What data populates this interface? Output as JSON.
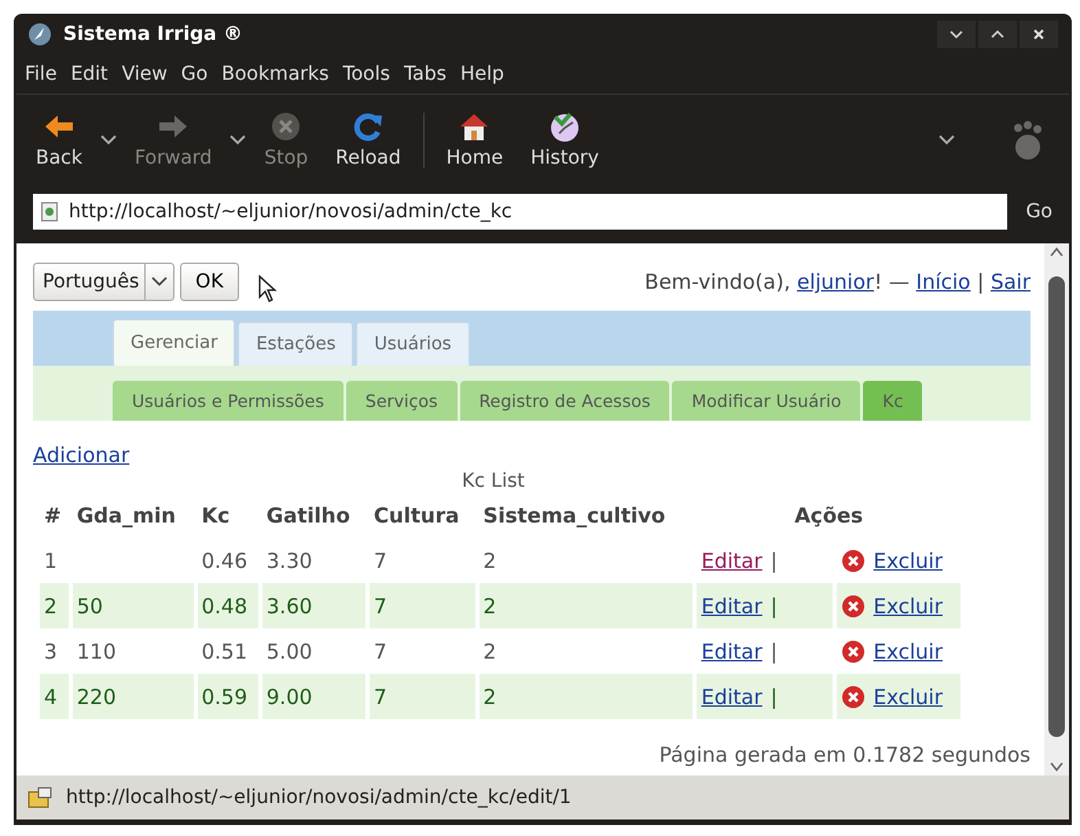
{
  "window": {
    "title": "Sistema Irriga ®"
  },
  "menu": [
    {
      "label": "File"
    },
    {
      "label": "Edit"
    },
    {
      "label": "View"
    },
    {
      "label": "Go"
    },
    {
      "label": "Bookmarks"
    },
    {
      "label": "Tools"
    },
    {
      "label": "Tabs"
    },
    {
      "label": "Help"
    }
  ],
  "toolbar": [
    {
      "kind": "back",
      "label": "Back",
      "disabled": false,
      "has_menu": true
    },
    {
      "kind": "forward",
      "label": "Forward",
      "disabled": true,
      "has_menu": true
    },
    {
      "kind": "stop",
      "label": "Stop",
      "disabled": true,
      "has_menu": false
    },
    {
      "kind": "reload",
      "label": "Reload",
      "disabled": false,
      "has_menu": false
    },
    {
      "kind": "home",
      "label": "Home",
      "disabled": false,
      "has_menu": false
    },
    {
      "kind": "history",
      "label": "History",
      "disabled": false,
      "has_menu": false
    }
  ],
  "address_bar": {
    "value": "http://localhost/~eljunior/novosi/admin/cte_kc",
    "go_label": "Go"
  },
  "page": {
    "language_select": {
      "value": "Português"
    },
    "ok_button": "OK",
    "greeting": [
      {
        "kind": "text",
        "text": "Bem-vindo(a), "
      },
      {
        "kind": "link",
        "text": "eljunior"
      },
      {
        "kind": "text",
        "text": "! — "
      },
      {
        "kind": "link",
        "text": "Início"
      },
      {
        "kind": "text",
        "text": " | "
      },
      {
        "kind": "link",
        "text": "Sair"
      }
    ],
    "tabs": [
      {
        "label": "Gerenciar",
        "selected": true
      },
      {
        "label": "Estações",
        "selected": false
      },
      {
        "label": "Usuários",
        "selected": false
      }
    ],
    "subtabs": [
      {
        "label": "Usuários e Permissões",
        "selected": false
      },
      {
        "label": "Serviços",
        "selected": false
      },
      {
        "label": "Registro de Acessos",
        "selected": false
      },
      {
        "label": "Modificar Usuário",
        "selected": false
      },
      {
        "label": "Kc",
        "selected": true
      }
    ],
    "add_link": "Adicionar",
    "table": {
      "caption": "Kc List",
      "columns": [
        "#",
        "Gda_min",
        "Kc",
        "Gatilho",
        "Cultura",
        "Sistema_cultivo",
        "Ações"
      ],
      "rows": [
        {
          "cells": [
            "1",
            "",
            "0.46",
            "3.30",
            "7",
            "2"
          ],
          "edit": "Editar",
          "edit_visited": true,
          "separator": "|",
          "delete": "Excluir"
        },
        {
          "cells": [
            "2",
            "50",
            "0.48",
            "3.60",
            "7",
            "2"
          ],
          "edit": "Editar",
          "edit_visited": false,
          "separator": "|",
          "delete": "Excluir"
        },
        {
          "cells": [
            "3",
            "110",
            "0.51",
            "5.00",
            "7",
            "2"
          ],
          "edit": "Editar",
          "edit_visited": false,
          "separator": "|",
          "delete": "Excluir"
        },
        {
          "cells": [
            "4",
            "220",
            "0.59",
            "9.00",
            "7",
            "2"
          ],
          "edit": "Editar",
          "edit_visited": false,
          "separator": "|",
          "delete": "Excluir"
        }
      ]
    },
    "footer": "Página gerada em 0.1782 segundos"
  },
  "status_bar": {
    "text": "http://localhost/~eljunior/novosi/admin/cte_kc/edit/1"
  }
}
